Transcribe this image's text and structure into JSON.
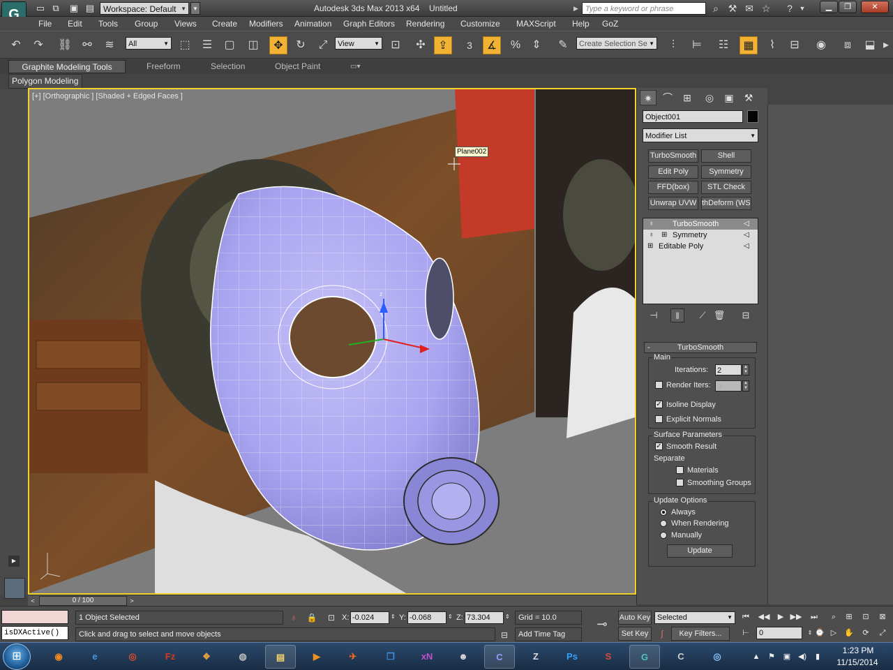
{
  "titlebar": {
    "workspace": "Workspace: Default",
    "app_title": "Autodesk 3ds Max  2013 x64",
    "doc_title": "Untitled",
    "search_placeholder": "Type a keyword or phrase",
    "quick_access_icons": [
      "new-icon",
      "open-icon",
      "save-icon",
      "undo-icon",
      "redo-icon",
      "project-icon"
    ]
  },
  "menu": [
    "File",
    "Edit",
    "Tools",
    "Group",
    "Views",
    "Create",
    "Modifiers",
    "Animation",
    "Graph Editors",
    "Rendering",
    "Customize",
    "MAXScript",
    "Help",
    "GoZ"
  ],
  "toolbar": {
    "selection_filter": "All",
    "ref_coord": "View",
    "snap_number": "3",
    "named_selection": "Create Selection Se"
  },
  "ribbon": {
    "tabs": [
      "Graphite Modeling Tools",
      "Freeform",
      "Selection",
      "Object Paint"
    ],
    "panel": "Polygon Modeling"
  },
  "viewport": {
    "label": "[+] [Orthographic ] [Shaded + Edged Faces ]",
    "tooltip": "Plane002",
    "gizmo_z": "z"
  },
  "command_panel": {
    "object_name": "Object001",
    "object_color": "#000000",
    "modifier_list": "Modifier List",
    "modifier_buttons": [
      "TurboSmooth",
      "Shell",
      "Edit Poly",
      "Symmetry",
      "FFD(box)",
      "STL Check",
      "Unwrap UVW",
      "thDeform (WSI"
    ],
    "stack": [
      "TurboSmooth",
      "Symmetry",
      "Editable Poly"
    ],
    "rollout": {
      "collapse": "-",
      "title": "TurboSmooth",
      "main_label": "Main",
      "iterations_label": "Iterations:",
      "iterations": "2",
      "render_iters_label": "Render Iters:",
      "render_iters": "0",
      "isoline_display": "Isoline Display",
      "explicit_normals": "Explicit Normals",
      "surface_params": "Surface Parameters",
      "smooth_result": "Smooth Result",
      "separate": "Separate",
      "materials": "Materials",
      "smoothing_groups": "Smoothing Groups",
      "update_options": "Update Options",
      "always": "Always",
      "when_rendering": "When Rendering",
      "manually": "Manually",
      "update_button": "Update"
    }
  },
  "timeline": {
    "frame": "0 / 100"
  },
  "status": {
    "maxscript_output": "isDXActive()",
    "selection": "1 Object Selected",
    "prompt": "Click and drag to select and move objects",
    "x_label": "X:",
    "x": "-0.024",
    "y_label": "Y:",
    "y": "-0.068",
    "z_label": "Z:",
    "z": "73.304",
    "grid": "Grid = 10.0",
    "add_time_tag": "Add Time Tag",
    "auto_key": "Auto Key",
    "set_key": "Set Key",
    "key_mode": "Selected",
    "key_filters": "Key Filters...",
    "frame_field": "0"
  },
  "taskbar": {
    "start": "⊞",
    "apps": [
      "Firefox",
      "Internet Explorer",
      "Chrome",
      "FileZilla",
      "App",
      "App",
      "Windows Explorer",
      "Media Player",
      "App",
      "Dropbox",
      "xN",
      "App",
      "App",
      "ZBrush",
      "Photoshop",
      "App",
      "3ds Max",
      "App",
      "App"
    ],
    "time": "1:23 PM",
    "date": "11/15/2014"
  },
  "colors": {
    "viewport_border": "#f0d22a",
    "active_tool": "#f2b233",
    "mesh": "#a9a4f0"
  }
}
